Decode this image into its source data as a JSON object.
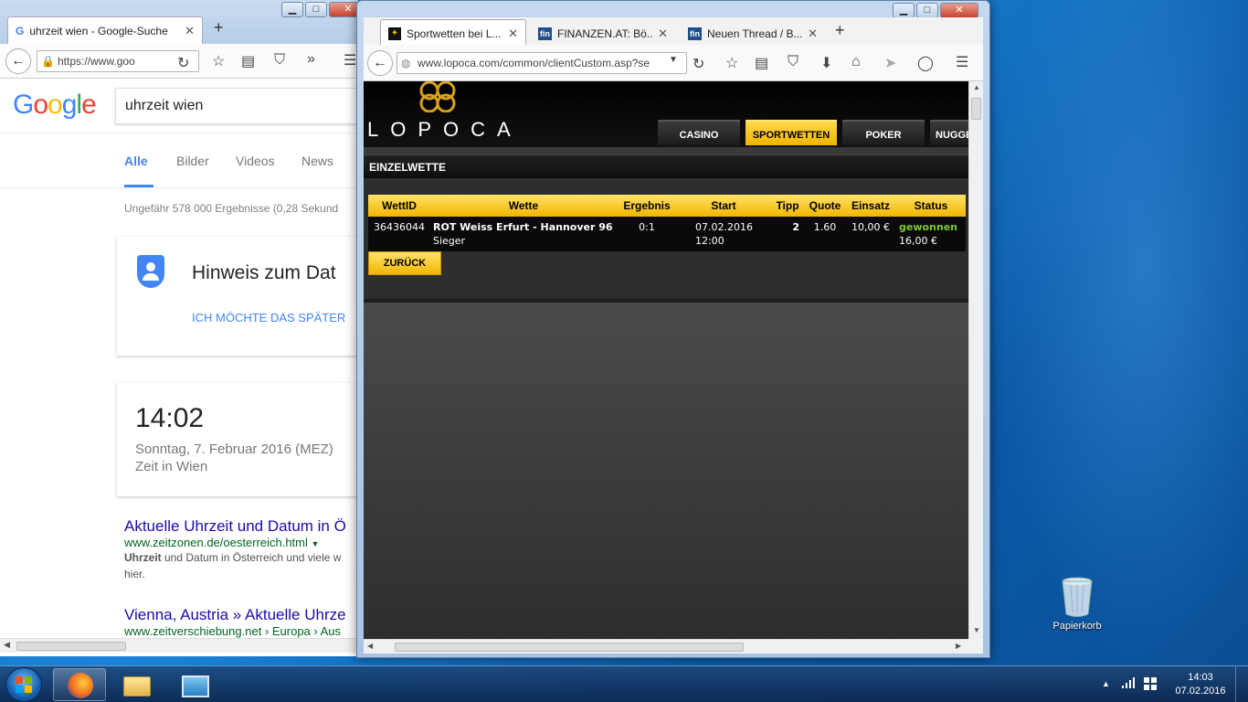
{
  "bg_window": {
    "tab_title": "uhrzeit wien - Google-Suche",
    "url": "https://www.goo",
    "search_query": "uhrzeit wien",
    "logo": "Google",
    "tabs": [
      "Alle",
      "Bilder",
      "Videos",
      "News"
    ],
    "result_count": "Ungefähr 578 000 Ergebnisse (0,28 Sekund",
    "notice_title": "Hinweis zum Dat",
    "notice_link": "ICH MÖCHTE DAS SPÄTER",
    "time_card": {
      "time": "14:02",
      "date": "Sonntag, 7. Februar 2016 (MEZ)",
      "place": "Zeit in Wien"
    },
    "results": [
      {
        "title": "Aktuelle Uhrzeit und Datum in Ö",
        "url": "www.zeitzonen.de/oesterreich.html",
        "snippet_bold": "Uhrzeit",
        "snippet_rest": " und Datum in Österreich und viele w",
        "snippet_line2": "hier."
      },
      {
        "title": "Vienna, Austria » Aktuelle Uhrze",
        "url": "www.zeitverschiebung.net › Europa › Aus"
      }
    ]
  },
  "fg_window": {
    "tabs": [
      {
        "label": "Sportwetten bei L...",
        "icon": "lopoca-favicon"
      },
      {
        "label": "FINANZEN.AT: Bö...",
        "icon": "fin-favicon"
      },
      {
        "label": "Neuen Thread / B...",
        "icon": "fin-favicon"
      }
    ],
    "url": "www.lopoca.com/common/clientCustom.asp?se",
    "logo_text": "LOPOCA",
    "menu": [
      "CASINO",
      "SPORTWETTEN",
      "POKER",
      "NUGGE"
    ],
    "active_menu": "SPORTWETTEN",
    "section_title": "EINZELWETTE",
    "table": {
      "headers": [
        "WettID",
        "Wette",
        "Ergebnis",
        "Start",
        "Tipp",
        "Quote",
        "Einsatz",
        "Status"
      ],
      "row": {
        "id": "36436044",
        "bet_bold": "ROT Weiss Erfurt - Hannover 96",
        "bet_rest": " Sieger",
        "result": "0:1",
        "start_date": "07.02.2016",
        "start_time": "12:00",
        "tip": "2",
        "odds": "1.60",
        "stake": "10,00 €",
        "status": "gewonnen",
        "payout": "16,00 €"
      }
    },
    "back_button": "ZURÜCK"
  },
  "desktop": {
    "recycle_bin": "Papierkorb"
  },
  "taskbar": {
    "time": "14:03",
    "date": "07.02.2016"
  }
}
